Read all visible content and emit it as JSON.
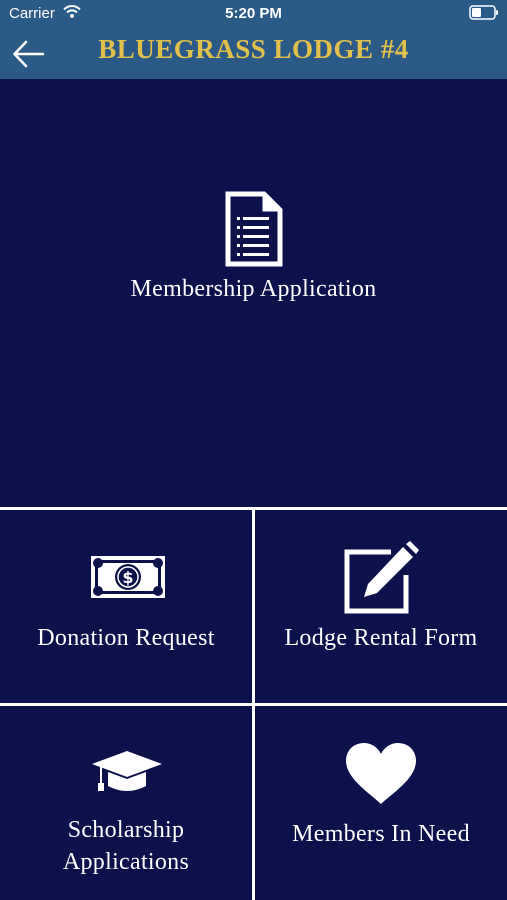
{
  "status_bar": {
    "carrier": "Carrier",
    "time": "5:20 PM",
    "wifi_icon": "wifi-icon",
    "battery_icon": "battery-icon"
  },
  "nav": {
    "title": "BLUEGRASS LODGE #4",
    "back_icon": "arrow-left-icon"
  },
  "tiles": [
    {
      "label": "Membership Application",
      "icon": "document-icon"
    },
    {
      "label": "Donation Request",
      "icon": "dollar-bill-icon"
    },
    {
      "label": "Lodge Rental Form",
      "icon": "edit-icon"
    },
    {
      "label_line1": "Scholarship",
      "label_line2": "Applications",
      "icon": "graduation-cap-icon"
    },
    {
      "label": "Members In Need",
      "icon": "heart-icon"
    }
  ],
  "colors": {
    "header_bg": "#2c5a86",
    "title_gold": "#e2c04c",
    "tile_bg": "#0c104b",
    "divider": "#ffffff"
  }
}
